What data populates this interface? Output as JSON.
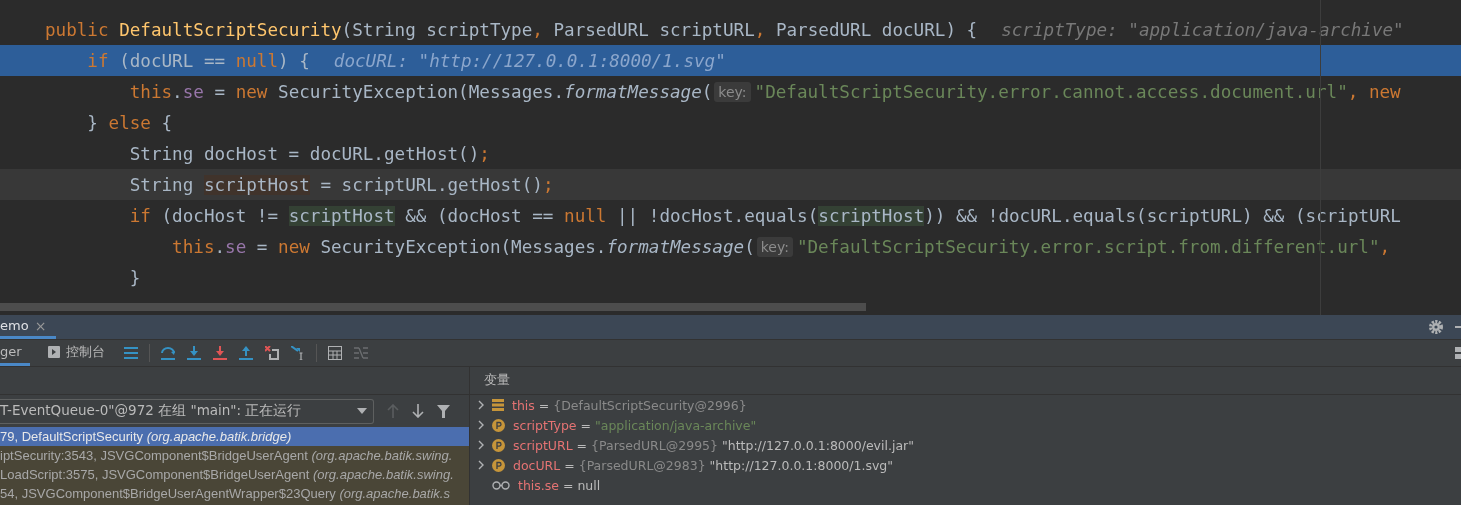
{
  "code": {
    "lines": [
      {
        "highlighted": false,
        "caret": false,
        "parts": [
          {
            "kind": "code",
            "tokens": [
              {
                "kind": "kw",
                "text": "public"
              },
              {
                "kind": "decl",
                "text": " DefaultScriptSecurity"
              },
              {
                "kind": "plain",
                "text": "(String scriptType"
              },
              {
                "kind": "punct",
                "text": ","
              },
              {
                "kind": "plain",
                "text": " ParsedURL scriptURL"
              },
              {
                "kind": "punct",
                "text": ","
              },
              {
                "kind": "plain",
                "text": " ParsedURL docURL) {"
              }
            ]
          },
          {
            "kind": "value",
            "text": "scriptType: \"application/java-archive\""
          }
        ]
      },
      {
        "highlighted": true,
        "parts": [
          {
            "kind": "code",
            "tokens": [
              {
                "kind": "kw",
                "text": "    if"
              },
              {
                "kind": "plain",
                "text": " (docURL == "
              },
              {
                "kind": "kw",
                "text": "null"
              },
              {
                "kind": "plain",
                "text": ") {"
              }
            ]
          },
          {
            "kind": "value",
            "text": "docURL: \"http://127.0.0.1:8000/1.svg\""
          }
        ]
      },
      {
        "highlighted": false,
        "caret": false,
        "parts": [
          {
            "kind": "code",
            "tokens": [
              {
                "kind": "kw",
                "text": "        this"
              },
              {
                "kind": "plain",
                "text": "."
              },
              {
                "kind": "field",
                "text": "se"
              },
              {
                "kind": "plain",
                "text": " = "
              },
              {
                "kind": "kw",
                "text": "new"
              },
              {
                "kind": "plain",
                "text": " SecurityException(Messages."
              },
              {
                "kind": "italic",
                "text": "formatMessage"
              },
              {
                "kind": "plain",
                "text": "("
              }
            ]
          },
          {
            "kind": "hint",
            "text": "key:"
          },
          {
            "kind": "code",
            "tokens": [
              {
                "kind": "str",
                "text": "\"DefaultScriptSecurity.error.cannot.access.document.url\""
              },
              {
                "kind": "punct",
                "text": ","
              },
              {
                "kind": "kw",
                "text": " new"
              }
            ]
          }
        ]
      },
      {
        "highlighted": false,
        "caret": false,
        "parts": [
          {
            "kind": "code",
            "tokens": [
              {
                "kind": "plain",
                "text": "    } "
              },
              {
                "kind": "kw",
                "text": "else"
              },
              {
                "kind": "plain",
                "text": " {"
              }
            ]
          }
        ]
      },
      {
        "highlighted": false,
        "caret": false,
        "parts": [
          {
            "kind": "code",
            "tokens": [
              {
                "kind": "plain",
                "text": "        String docHost = docURL.getHost()"
              },
              {
                "kind": "punct",
                "text": ";"
              }
            ]
          }
        ]
      },
      {
        "highlighted": false,
        "caret": true,
        "parts": [
          {
            "kind": "code",
            "tokens": [
              {
                "kind": "plain",
                "text": "        String "
              },
              {
                "kind": "write",
                "text": "scriptHost"
              },
              {
                "kind": "plain",
                "text": " = scriptURL.getHost()"
              },
              {
                "kind": "punct",
                "text": ";"
              }
            ]
          }
        ]
      },
      {
        "highlighted": false,
        "caret": false,
        "parts": [
          {
            "kind": "code",
            "tokens": [
              {
                "kind": "kw",
                "text": "        if"
              },
              {
                "kind": "plain",
                "text": " (docHost != "
              },
              {
                "kind": "read",
                "text": "scriptHost"
              },
              {
                "kind": "plain",
                "text": " && (docHost == "
              },
              {
                "kind": "kw",
                "text": "null"
              },
              {
                "kind": "plain",
                "text": " || !docHost.equals("
              },
              {
                "kind": "read",
                "text": "scriptHost"
              },
              {
                "kind": "plain",
                "text": ")) && !docURL.equals(scriptURL) && (scriptURL"
              }
            ]
          }
        ]
      },
      {
        "highlighted": false,
        "caret": false,
        "parts": [
          {
            "kind": "code",
            "tokens": [
              {
                "kind": "kw",
                "text": "            this"
              },
              {
                "kind": "plain",
                "text": "."
              },
              {
                "kind": "field",
                "text": "se"
              },
              {
                "kind": "plain",
                "text": " = "
              },
              {
                "kind": "kw",
                "text": "new"
              },
              {
                "kind": "plain",
                "text": " SecurityException(Messages."
              },
              {
                "kind": "italic",
                "text": "formatMessage"
              },
              {
                "kind": "plain",
                "text": "("
              }
            ]
          },
          {
            "kind": "hint",
            "text": "key:"
          },
          {
            "kind": "code",
            "tokens": [
              {
                "kind": "str",
                "text": "\"DefaultScriptSecurity.error.script.from.different.url\""
              },
              {
                "kind": "punct",
                "text": ","
              }
            ]
          }
        ]
      },
      {
        "highlighted": false,
        "caret": false,
        "parts": [
          {
            "kind": "code",
            "tokens": [
              {
                "kind": "plain",
                "text": "        }"
              }
            ]
          }
        ]
      }
    ]
  },
  "tool_window": {
    "tab": {
      "label": "emo",
      "close": "×",
      "selected": true
    }
  },
  "debug_tabs": [
    {
      "label": "ger",
      "selected": true,
      "icon": false
    },
    {
      "label": "控制台",
      "selected": false,
      "icon": true
    }
  ],
  "thread_selector": {
    "value": "T-EventQueue-0\"@972 在组 \"main\": 正在运行"
  },
  "frames": [
    {
      "name": "79, DefaultScriptSecurity",
      "package": "(org.apache.batik.bridge)",
      "selected": true
    },
    {
      "name": "iptSecurity:3543, JSVGComponent$BridgeUserAgent",
      "package": "(org.apache.batik.swing.",
      "selected": false
    },
    {
      "name": "LoadScript:3575, JSVGComponent$BridgeUserAgent",
      "package": "(org.apache.batik.swing.",
      "selected": false
    },
    {
      "name": "54, JSVGComponent$BridgeUserAgentWrapper$23Query",
      "package": "(org.apache.batik.s",
      "selected": false
    }
  ],
  "variables": {
    "title": "变量",
    "items": [
      {
        "kind": "field",
        "expandable": true,
        "name": "this",
        "operator": "=",
        "ref": "{DefaultScriptSecurity@2996}"
      },
      {
        "kind": "param",
        "expandable": true,
        "name": "scriptType",
        "operator": "=",
        "value": {
          "kind": "string",
          "text": "\"application/java-archive\""
        }
      },
      {
        "kind": "param",
        "expandable": true,
        "name": "scriptURL",
        "operator": "=",
        "ref": "{ParsedURL@2995}",
        "value": {
          "kind": "plain",
          "text": "\"http://127.0.0.1:8000/evil.jar\""
        }
      },
      {
        "kind": "param",
        "expandable": true,
        "name": "docURL",
        "operator": "=",
        "ref": "{ParsedURL@2983}",
        "value": {
          "kind": "plain",
          "text": "\"http://127.0.0.1:8000/1.svg\""
        }
      },
      {
        "kind": "watch",
        "expandable": false,
        "name": "this.se",
        "operator": "=",
        "value": {
          "kind": "plain",
          "text": "null"
        }
      }
    ]
  }
}
